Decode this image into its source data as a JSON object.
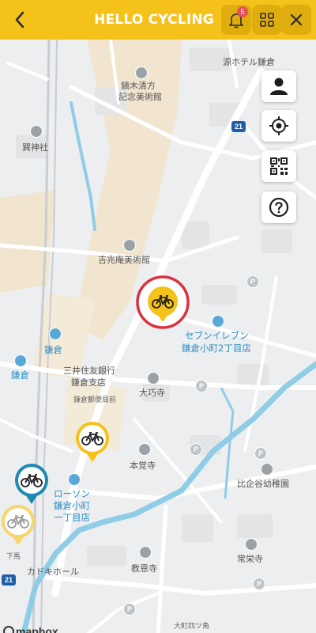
{
  "header": {
    "title": "HELLO CYCLING",
    "notification_count": "5",
    "accent_color": "#f5c21b"
  },
  "map": {
    "labels": {
      "hotel": "源ホテル鎌倉",
      "museum_kaburaki_1": "鏑木清方",
      "museum_kaburaki_2": "記念美術館",
      "shrine": "巽神社",
      "kicchoan": "吉兆庵美術館",
      "seven_1": "セブンイレブン",
      "seven_2": "鎌倉小町2丁目店",
      "station": "鎌倉",
      "station2": "鎌倉",
      "bank_1": "三井住友銀行",
      "bank_2": "鎌倉支店",
      "post_office": "鎌倉郵便局前",
      "daigyoji": "大巧寺",
      "hongakuji": "本覚寺",
      "kindergarten": "比企谷幼稚園",
      "lawson_1": "ローソン",
      "lawson_2": "鎌倉小町",
      "lawson_3": "一丁目店",
      "shimouma": "下馬",
      "kadoki": "カドキホール",
      "kyoonji": "教恩寺",
      "joeiji": "常栄寺",
      "omachi": "大町四ツ角",
      "route_21": "21",
      "route_21_b": "21",
      "mapbox": "mapbox"
    }
  },
  "controls": {
    "profile": "person-icon",
    "locate": "crosshair-icon",
    "qr": "qr-code-icon",
    "help": "help-icon"
  },
  "colors": {
    "pin_yellow": "#f5c21b",
    "pin_teal": "#1f8ab0",
    "selected_ring": "#d9333f",
    "river": "#8fcde6"
  }
}
